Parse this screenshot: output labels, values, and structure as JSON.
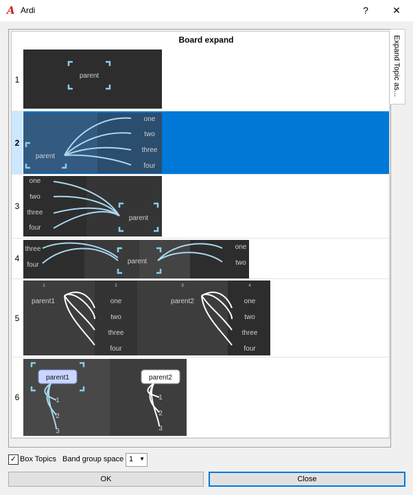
{
  "window": {
    "title": "Ardi",
    "app_icon": "A",
    "help_glyph": "?",
    "close_glyph": "✕"
  },
  "grid": {
    "header": "Board expand",
    "rows": [
      {
        "num": "1",
        "labels": {
          "parent": "parent"
        }
      },
      {
        "num": "2",
        "selected": true,
        "labels": {
          "parent": "parent",
          "children": [
            "one",
            "two",
            "three",
            "four"
          ]
        }
      },
      {
        "num": "3",
        "labels": {
          "parent": "parent",
          "children": [
            "one",
            "two",
            "three",
            "four"
          ]
        }
      },
      {
        "num": "4",
        "labels": {
          "parent": "parent",
          "left": [
            "three",
            "four"
          ],
          "right": [
            "one",
            "two"
          ]
        }
      },
      {
        "num": "5",
        "labels": {
          "parents": [
            "parent1",
            "parent2"
          ],
          "children": [
            "one",
            "two",
            "three",
            "four"
          ],
          "bands": [
            "1",
            "2",
            "3",
            "4"
          ]
        }
      },
      {
        "num": "6",
        "labels": {
          "parents": [
            "parent1",
            "parent2"
          ],
          "children": [
            "1",
            "2",
            "3"
          ]
        }
      }
    ]
  },
  "side_tab": {
    "label": "Expand Topic as..."
  },
  "options": {
    "box_topics_label": "Box Topics",
    "box_topics_checked": true,
    "band_group_space_label": "Band group space",
    "band_group_space_value": "1"
  },
  "buttons": {
    "ok": "OK",
    "close": "Close"
  },
  "colors": {
    "accent": "#0078d7",
    "thumb_bg": "#2d2d2d",
    "connector": "#87ceeb",
    "app_icon": "#d01c1c"
  }
}
